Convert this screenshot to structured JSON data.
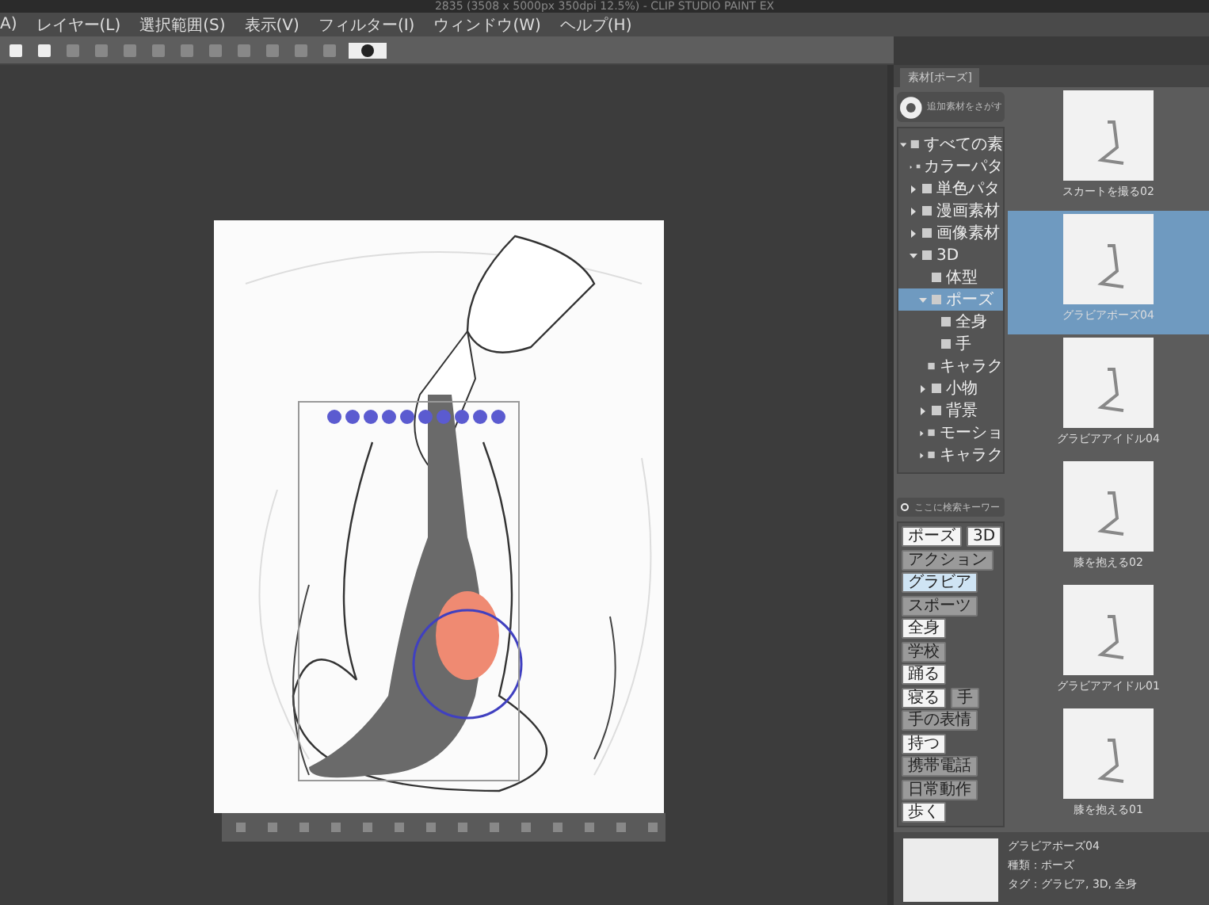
{
  "window": {
    "title": "2835 (3508 x 5000px 350dpi 12.5%) - CLIP STUDIO PAINT EX"
  },
  "menu": [
    "A)",
    "レイヤー(L)",
    "選択範囲(S)",
    "表示(V)",
    "フィルター(I)",
    "ウィンドウ(W)",
    "ヘルプ(H)"
  ],
  "panel": {
    "tab": "素材[ポーズ]",
    "search": {
      "placeholder": "追加素材をさがす"
    },
    "tree": [
      {
        "label": "すべての素",
        "expanded": true,
        "selected": false,
        "children": [
          {
            "label": "カラーパタ",
            "expanded": false,
            "selected": false
          },
          {
            "label": "単色パタ",
            "expanded": false,
            "selected": false
          },
          {
            "label": "漫画素材",
            "expanded": false,
            "selected": false
          },
          {
            "label": "画像素材",
            "expanded": false,
            "selected": false
          },
          {
            "label": "3D",
            "expanded": true,
            "selected": false,
            "children": [
              {
                "label": "体型",
                "selected": false
              },
              {
                "label": "ポーズ",
                "expanded": true,
                "selected": true,
                "children": [
                  {
                    "label": "全身",
                    "selected": false
                  },
                  {
                    "label": "手",
                    "selected": false
                  }
                ]
              },
              {
                "label": "キャラク",
                "selected": false
              },
              {
                "label": "小物",
                "expanded": false,
                "selected": false
              },
              {
                "label": "背景",
                "expanded": false,
                "selected": false
              },
              {
                "label": "モーショ",
                "expanded": false,
                "selected": false
              },
              {
                "label": "キャラク",
                "expanded": false,
                "selected": false
              }
            ]
          }
        ]
      }
    ],
    "keyword": {
      "placeholder": "ここに検索キーワー"
    },
    "tag_rows": [
      [
        {
          "label": "ポーズ",
          "kind": "active",
          "selected": false
        },
        {
          "label": "3D",
          "kind": "active",
          "selected": false
        }
      ],
      [
        {
          "label": "アクション",
          "kind": "inactive",
          "selected": false
        }
      ],
      [
        {
          "label": "グラビア",
          "kind": "inactive",
          "selected": true
        }
      ],
      [
        {
          "label": "スポーツ",
          "kind": "inactive",
          "selected": false
        }
      ],
      [
        {
          "label": "全身",
          "kind": "active",
          "selected": false
        }
      ],
      [
        {
          "label": "学校",
          "kind": "inactive",
          "selected": false
        }
      ],
      [
        {
          "label": "踊る",
          "kind": "active",
          "selected": false
        }
      ],
      [
        {
          "label": "寝る",
          "kind": "active",
          "selected": false
        },
        {
          "label": "手",
          "kind": "inactive",
          "selected": false
        }
      ],
      [
        {
          "label": "手の表情",
          "kind": "inactive",
          "selected": false
        }
      ],
      [
        {
          "label": "持つ",
          "kind": "active",
          "selected": false
        }
      ],
      [
        {
          "label": "携帯電話",
          "kind": "inactive",
          "selected": false
        }
      ],
      [
        {
          "label": "日常動作",
          "kind": "inactive",
          "selected": false
        }
      ],
      [
        {
          "label": "歩く",
          "kind": "active",
          "selected": false
        }
      ]
    ],
    "materials": [
      {
        "label": "スカートを撮る02",
        "selected": false
      },
      {
        "label": "グラビアポーズ04",
        "selected": true
      },
      {
        "label": "グラビアアイドル04",
        "selected": false
      },
      {
        "label": "膝を抱える02",
        "selected": false
      },
      {
        "label": "グラビアアイドル01",
        "selected": false
      },
      {
        "label": "膝を抱える01",
        "selected": false
      }
    ],
    "info": {
      "name": "グラビアポーズ04",
      "type": "種類：ポーズ",
      "tags": "タグ：グラビア, 3D, 全身"
    }
  }
}
